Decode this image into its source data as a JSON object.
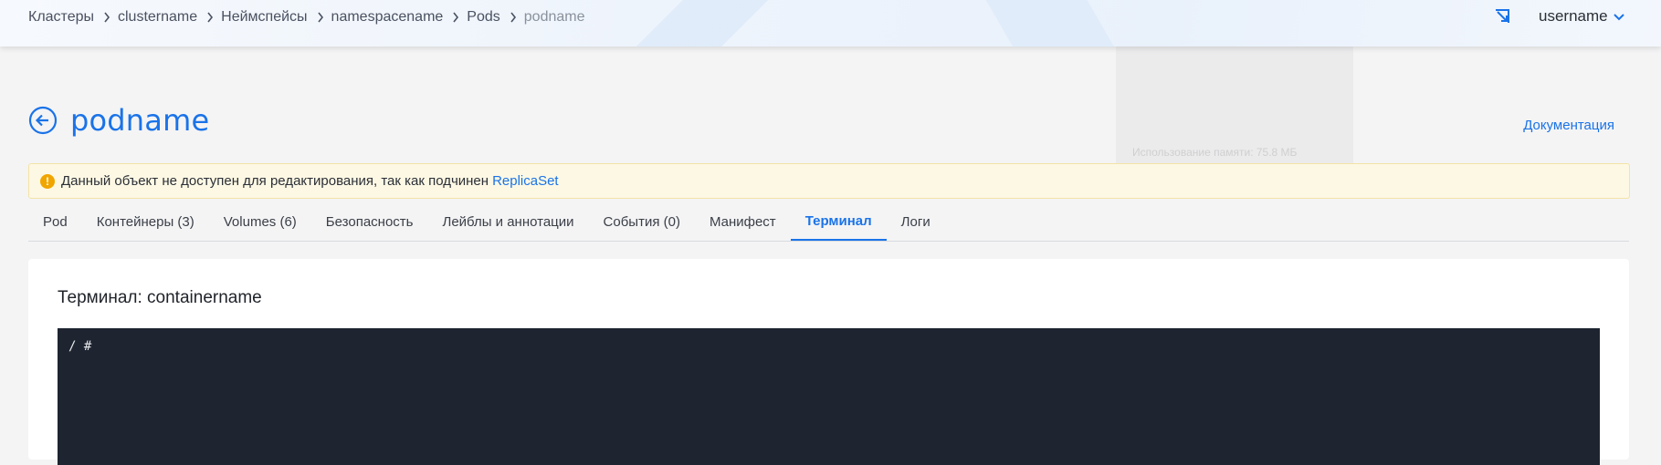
{
  "breadcrumb": [
    {
      "label": "Кластеры"
    },
    {
      "label": "clustername"
    },
    {
      "label": "Неймспейсы"
    },
    {
      "label": "namespacename"
    },
    {
      "label": "Pods"
    },
    {
      "label": "podname"
    }
  ],
  "header": {
    "username": "username"
  },
  "page": {
    "title": "podname",
    "doc_link": "Документация"
  },
  "warning": {
    "text": "Данный объект не доступен для редактирования, так как подчинен",
    "link": "ReplicaSet"
  },
  "tabs": [
    {
      "label": "Pod"
    },
    {
      "label": "Контейнеры (3)"
    },
    {
      "label": "Volumes (6)"
    },
    {
      "label": "Безопасность"
    },
    {
      "label": "Лейблы и аннотации"
    },
    {
      "label": "События (0)"
    },
    {
      "label": "Манифест"
    },
    {
      "label": "Терминал",
      "active": true
    },
    {
      "label": "Логи"
    }
  ],
  "terminal": {
    "title": "Терминал: containername",
    "prompt": "/ #"
  },
  "background_overlay": {
    "text": "Использование памяти: 75.8 МБ"
  },
  "colors": {
    "accent": "#1a73e8",
    "warning_bg": "#fdf8e4",
    "warning_icon": "#f0a500",
    "terminal_bg": "#1e2430"
  }
}
